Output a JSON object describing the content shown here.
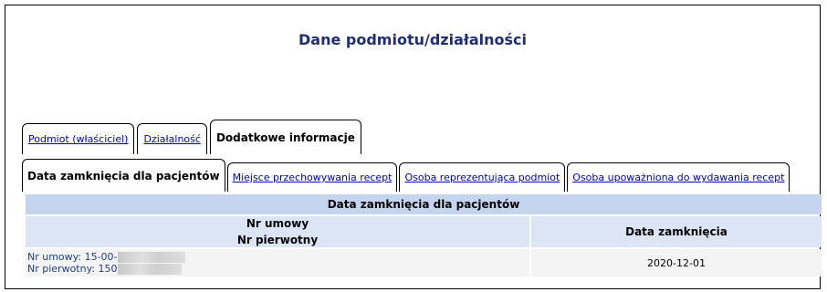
{
  "page": {
    "title": "Dane podmiotu/działalności"
  },
  "tabs_main": [
    {
      "label": "Podmiot (właściciel)",
      "active": false
    },
    {
      "label": "Działalność",
      "active": false
    },
    {
      "label": "Dodatkowe informacje",
      "active": true
    }
  ],
  "tabs_sub": [
    {
      "label": "Data zamknięcia dla pacjentów",
      "active": true
    },
    {
      "label": "Miejsce przechowywania recept",
      "active": false
    },
    {
      "label": "Osoba reprezentująca podmiot",
      "active": false
    },
    {
      "label": "Osoba upoważniona do wydawania recept",
      "active": false
    }
  ],
  "table": {
    "caption": "Data zamknięcia dla pacjentów",
    "col1_line1": "Nr umowy",
    "col1_line2": "Nr pierwotny",
    "col2": "Data zamknięcia",
    "rows": [
      {
        "nr_umowy_label": "Nr umowy:",
        "nr_umowy_value": "15-00-",
        "nr_pierwotny_label": "Nr pierwotny:",
        "nr_pierwotny_value": "150",
        "data_zamkniecia": "2020-12-01"
      }
    ]
  }
}
